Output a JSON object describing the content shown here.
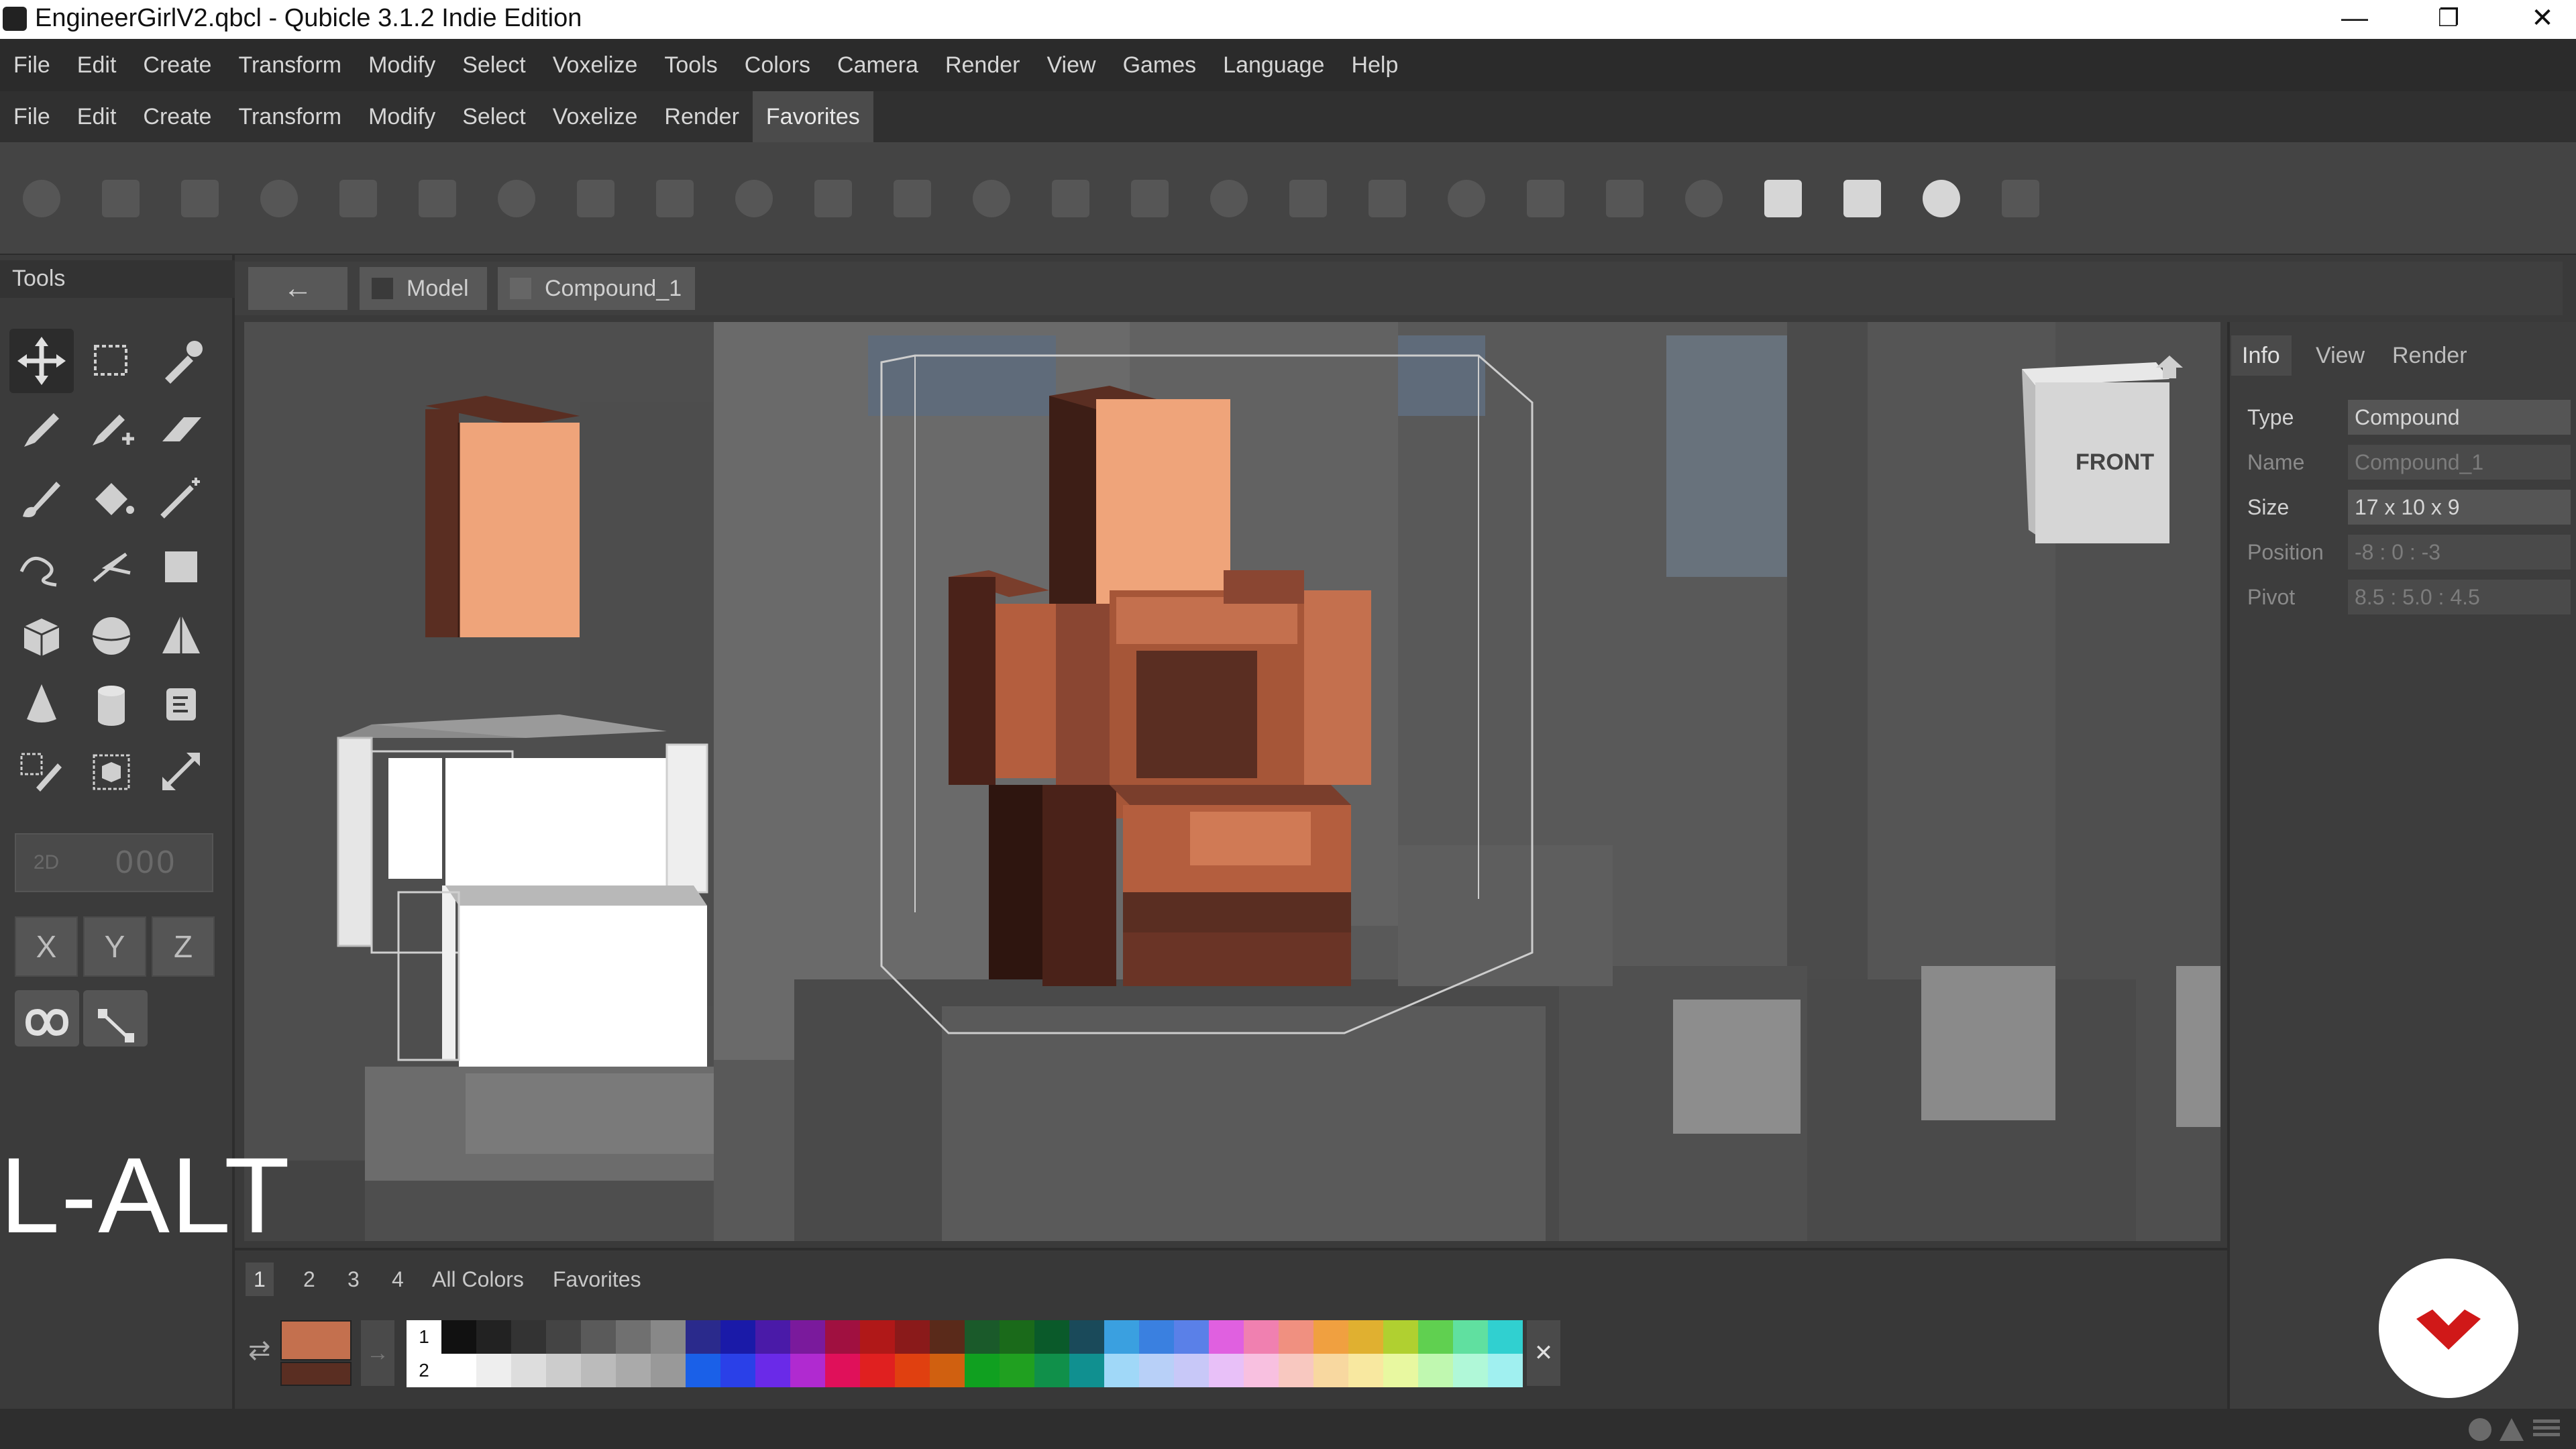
{
  "window": {
    "title": "EngineerGirlV2.qbcl - Qubicle 3.1.2 Indie Edition",
    "minimize": "—",
    "restore": "❐",
    "close": "✕"
  },
  "menubar_main": [
    "File",
    "Edit",
    "Create",
    "Transform",
    "Modify",
    "Select",
    "Voxelize",
    "Tools",
    "Colors",
    "Camera",
    "Render",
    "View",
    "Games",
    "Language",
    "Help"
  ],
  "menubar_secondary": [
    "File",
    "Edit",
    "Create",
    "Transform",
    "Modify",
    "Select",
    "Voxelize",
    "Render",
    "Favorites"
  ],
  "menubar_secondary_active": "Favorites",
  "toolbar_icons": [
    "redo-icon",
    "copy-icon",
    "frame-icon",
    "align-left-icon",
    "align-center-icon",
    "align-right-icon",
    "stamp-icon",
    "stamp-2-icon",
    "stamp-3-icon",
    "sphere-icon",
    "cube-pair-icon",
    "sphere-2-icon",
    "sphere-3-icon",
    "eye-icon",
    "eye-2-icon",
    "pen-icon",
    "pen-2-icon",
    "square-icon",
    "mirror-icon",
    "merge-icon",
    "split-icon",
    "paint-icon",
    "cube-icon",
    "fit-icon",
    "fullscreen-icon",
    "overlap-icon"
  ],
  "tools_panel": {
    "title": "Tools",
    "toggle_2d": "2D",
    "toggle_grid": "000",
    "axes": [
      "X",
      "Y",
      "Z"
    ]
  },
  "breadcrumb": {
    "back": "←",
    "items": [
      "Model",
      "Compound_1"
    ]
  },
  "viewcube": {
    "label": "FRONT"
  },
  "right_panel": {
    "tabs": [
      "Info",
      "View",
      "Render"
    ],
    "active_tab": "Info",
    "properties": [
      {
        "label": "Type",
        "value": "Compound",
        "enabled": true
      },
      {
        "label": "Name",
        "value": "Compound_1",
        "enabled": false
      },
      {
        "label": "Size",
        "value": "17 x 10 x 9",
        "enabled": true
      },
      {
        "label": "Position",
        "value": "-8 : 0 : -3",
        "enabled": false
      },
      {
        "label": "Pivot",
        "value": "8.5 : 5.0 : 4.5",
        "enabled": false
      }
    ]
  },
  "palette": {
    "tabs": [
      "1",
      "2",
      "3",
      "4",
      "All Colors",
      "Favorites"
    ],
    "active_tab": "1",
    "row_labels": [
      "1",
      "2"
    ],
    "primary_color": "#c4704e",
    "secondary_color": "#5a2e22",
    "row1": [
      "#111111",
      "#222222",
      "#333333",
      "#444444",
      "#5a5a5a",
      "#707070",
      "#888888",
      "#2a2a8c",
      "#1a1aa8",
      "#4a1aa8",
      "#7a1a9c",
      "#a01040",
      "#b01818",
      "#8a1a1a",
      "#5a2a1a",
      "#1a5a2a",
      "#1a6a1a",
      "#0a5a2a",
      "#1a4a5a",
      "#3aa0e0",
      "#3a80e0",
      "#5a80e8",
      "#e060e0",
      "#f080b0",
      "#f09080",
      "#f0a040",
      "#e0b030",
      "#b0d030",
      "#60d050",
      "#60e0a0",
      "#30d0d0"
    ],
    "row2": [
      "#ffffff",
      "#eeeeee",
      "#dddddd",
      "#cccccc",
      "#bbbbbb",
      "#aaaaaa",
      "#999999",
      "#1a60e8",
      "#2a40e8",
      "#6a2ae8",
      "#b02ad0",
      "#e0105a",
      "#e02020",
      "#e04010",
      "#d06010",
      "#10a020",
      "#20a020",
      "#10904a",
      "#109090",
      "#a0d8f8",
      "#b8d0f8",
      "#c8c8f8",
      "#e8c0f8",
      "#f8c0e0",
      "#f8c8c0",
      "#f8d8a0",
      "#f8e8a0",
      "#e8f8a0",
      "#c0f8b0",
      "#b0f8d8",
      "#a0f0f0"
    ],
    "close": "✕"
  },
  "overlay_text": "L-ALT",
  "colors": {
    "skin": "#efa47a",
    "brown_light": "#c4704e",
    "brown_dark": "#5a2e22",
    "accent_red": "#d01818"
  }
}
